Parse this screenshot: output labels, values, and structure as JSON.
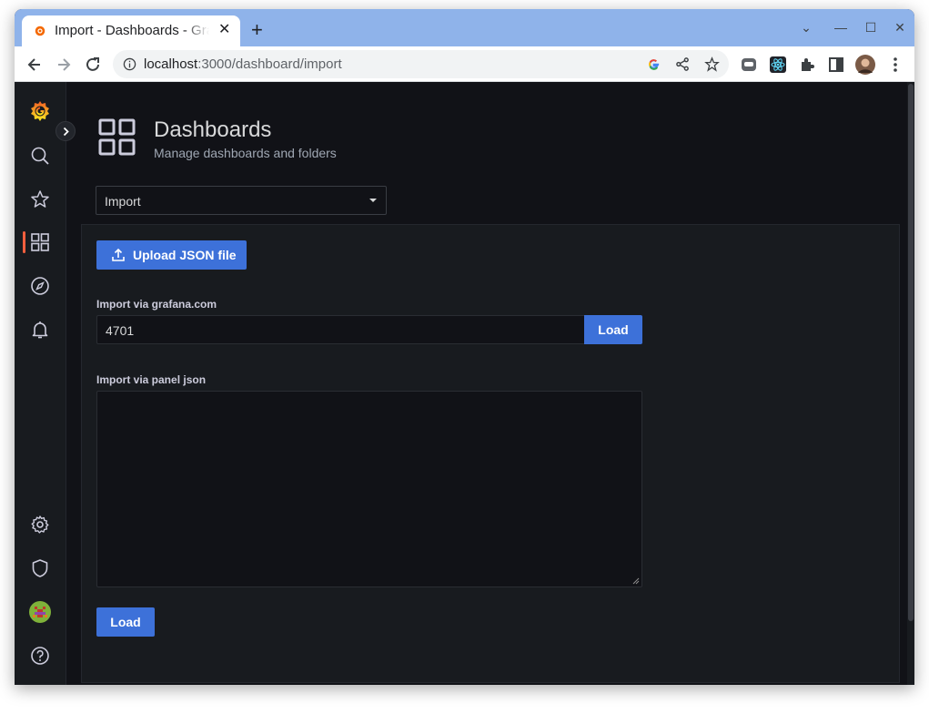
{
  "browser": {
    "tab_title": "Import - Dashboards - Grafana",
    "url_host": "localhost",
    "url_path": ":3000/dashboard/import"
  },
  "page": {
    "title": "Dashboards",
    "subtitle": "Manage dashboards and folders"
  },
  "tab_select": {
    "value": "Import"
  },
  "import": {
    "upload_label": "Upload JSON file",
    "gcom_label": "Import via grafana.com",
    "gcom_value": "4701",
    "load_label": "Load",
    "panel_json_label": "Import via panel json",
    "panel_json_value": "",
    "load2_label": "Load"
  },
  "sidemenu": {
    "items": [
      "grafana-logo",
      "search",
      "starred",
      "dashboards",
      "explore",
      "alerting",
      "configuration",
      "server-admin",
      "profile",
      "help"
    ]
  },
  "colors": {
    "primary": "#3d71d9",
    "active": "#f55f3e",
    "background": "#111217"
  }
}
